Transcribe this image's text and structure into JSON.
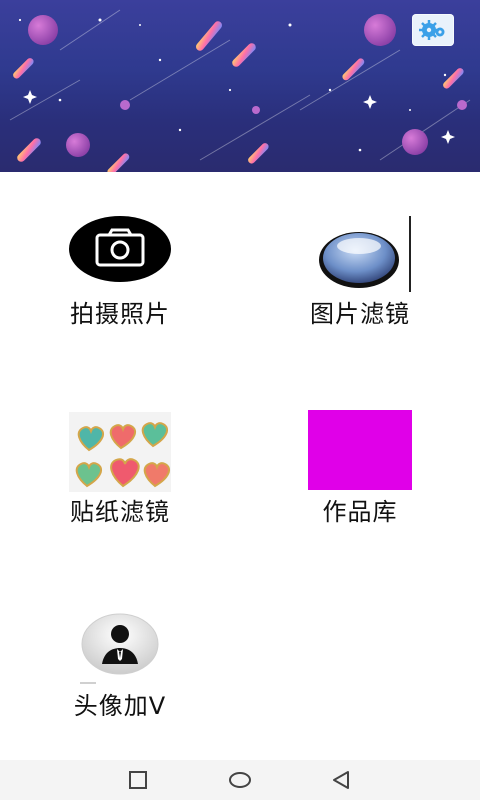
{
  "menu": {
    "items": [
      {
        "label": "拍摄照片"
      },
      {
        "label": "图片滤镜"
      },
      {
        "label": "贴纸滤镜"
      },
      {
        "label": "作品库"
      },
      {
        "label": "头像加V"
      }
    ]
  },
  "colors": {
    "banner_top": "#3b3f9c",
    "banner_bottom": "#2a2b6f",
    "gallery_swatch": "#e000e8",
    "camera_bg": "#000000"
  },
  "icons": {
    "settings": "gear-icon",
    "camera": "camera-icon",
    "filter": "glass-lens-icon",
    "stickers": "hearts-sticker-icon",
    "gallery": "magenta-square-icon",
    "avatar": "person-suit-icon",
    "nav_recent": "square-icon",
    "nav_home": "circle-icon",
    "nav_back": "triangle-back-icon"
  }
}
